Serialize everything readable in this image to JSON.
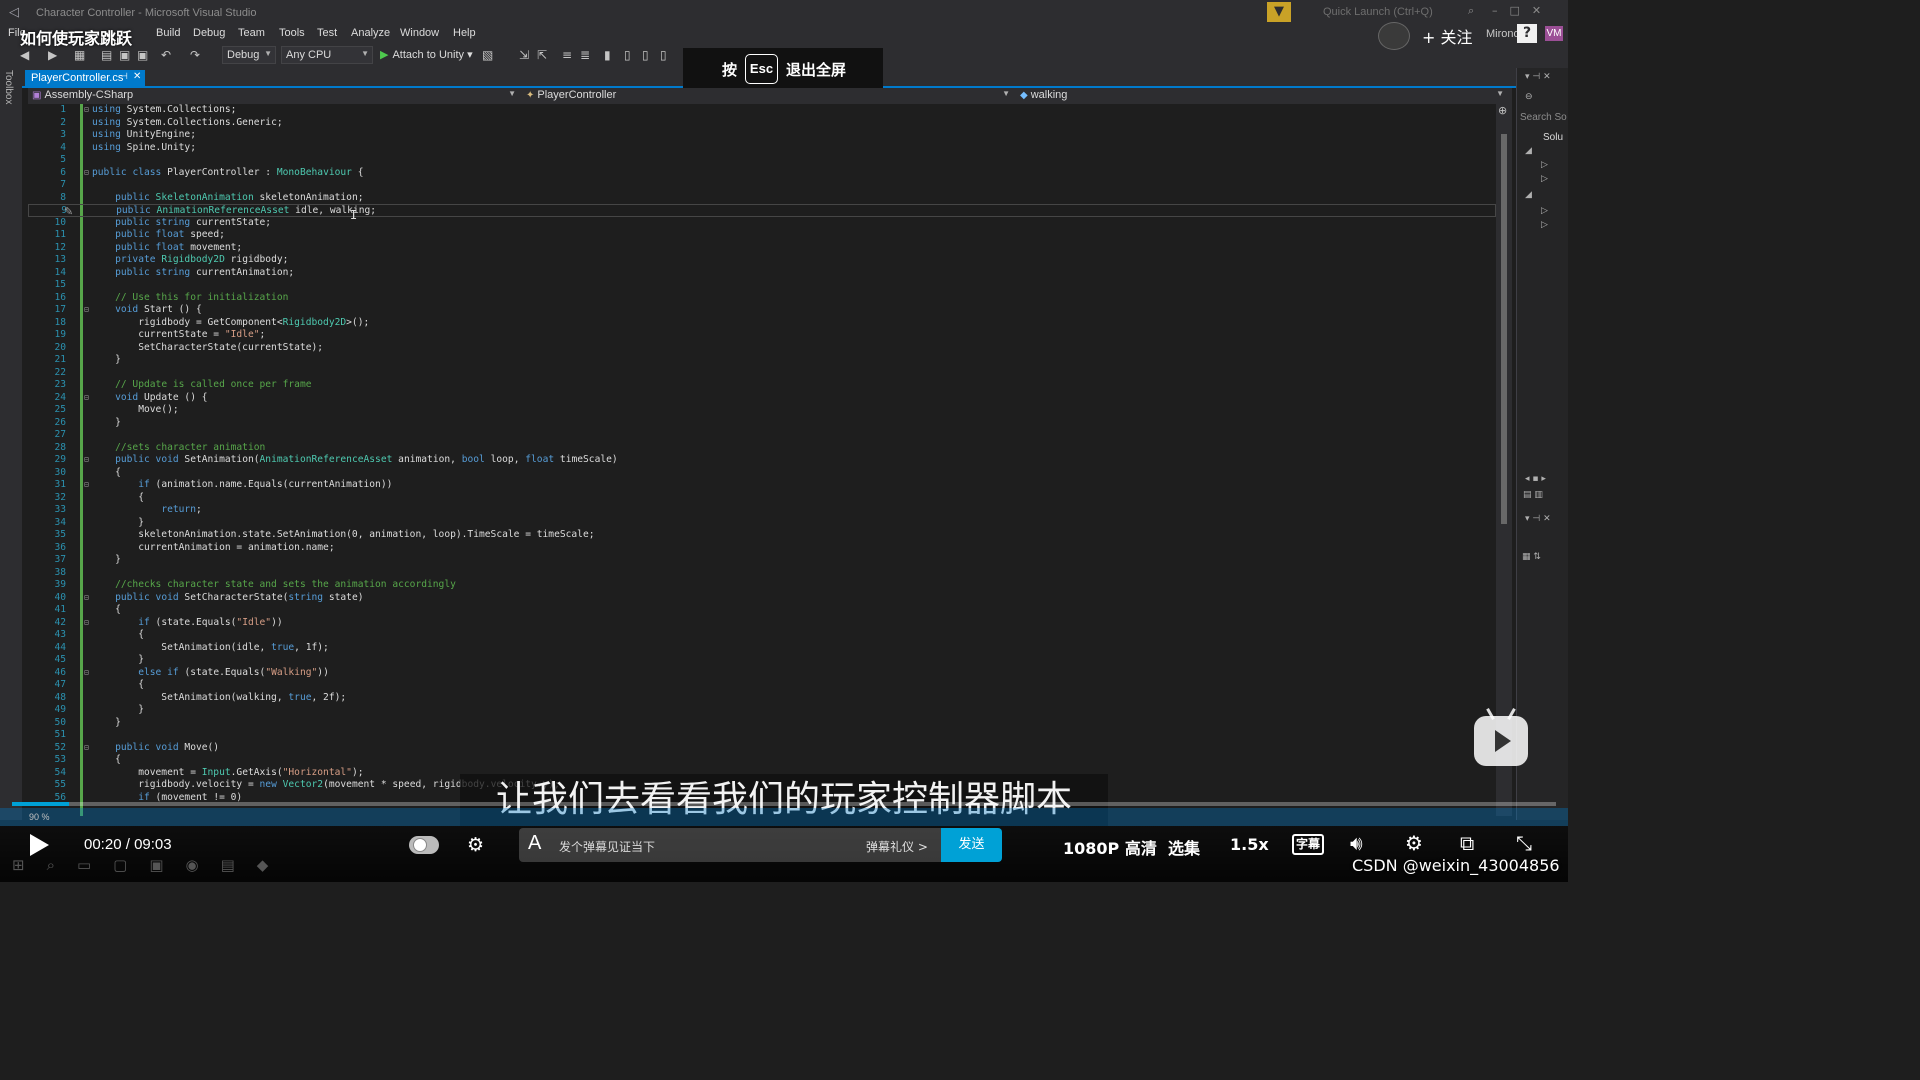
{
  "window": {
    "title": "Character Controller - Microsoft Visual Studio",
    "quick_launch_placeholder": "Quick Launch (Ctrl+Q)",
    "user_name": "Mirono",
    "user_initials": "VM",
    "help_glyph": "?"
  },
  "menu": [
    "File",
    "Build",
    "Debug",
    "Team",
    "Tools",
    "Test",
    "Analyze",
    "Window",
    "Help"
  ],
  "toolbar": {
    "config": "Debug",
    "platform": "Any CPU",
    "attach": "Attach to Unity"
  },
  "toolbox_label": "Toolbox",
  "tab": {
    "label": "PlayerController.cs"
  },
  "navbar": {
    "project": "Assembly-CSharp",
    "class": "PlayerController",
    "member": "walking"
  },
  "editor": {
    "zoom": "90 %",
    "current_line": 9,
    "lines": [
      "using System.Collections;",
      "using System.Collections.Generic;",
      "using UnityEngine;",
      "using Spine.Unity;",
      "",
      "public class PlayerController : MonoBehaviour {",
      "",
      "    public SkeletonAnimation skeletonAnimation;",
      "    public AnimationReferenceAsset idle, walking;",
      "    public string currentState;",
      "    public float speed;",
      "    public float movement;",
      "    private Rigidbody2D rigidbody;",
      "    public string currentAnimation;",
      "",
      "    // Use this for initialization",
      "    void Start () {",
      "        rigidbody = GetComponent<Rigidbody2D>();",
      "        currentState = \"Idle\";",
      "        SetCharacterState(currentState);",
      "    }",
      "",
      "    // Update is called once per frame",
      "    void Update () {",
      "        Move();",
      "    }",
      "",
      "    //sets character animation",
      "    public void SetAnimation(AnimationReferenceAsset animation, bool loop, float timeScale)",
      "    {",
      "        if (animation.name.Equals(currentAnimation))",
      "        {",
      "            return;",
      "        }",
      "        skeletonAnimation.state.SetAnimation(0, animation, loop).TimeScale = timeScale;",
      "        currentAnimation = animation.name;",
      "    }",
      "",
      "    //checks character state and sets the animation accordingly",
      "    public void SetCharacterState(string state)",
      "    {",
      "        if (state.Equals(\"Idle\"))",
      "        {",
      "            SetAnimation(idle, true, 1f);",
      "        }",
      "        else if (state.Equals(\"Walking\"))",
      "        {",
      "            SetAnimation(walking, true, 2f);",
      "        }",
      "    }",
      "",
      "    public void Move()",
      "    {",
      "        movement = Input.GetAxis(\"Horizontal\");",
      "        rigidbody.velocity = new Vector2(movement * speed, rigidbody.velocity.y);",
      "        if (movement != 0)"
    ],
    "fold_lines": [
      1,
      6,
      17,
      24,
      29,
      31,
      40,
      42,
      46,
      52
    ]
  },
  "solution_panel": {
    "search": "Search So",
    "solution": "Solu"
  },
  "overlay": {
    "video_title": "如何使玩家跳跃",
    "follow": "+ 关注",
    "esc_prefix": "按",
    "esc_key": "Esc",
    "esc_suffix": "退出全屏",
    "subtitle": "让我们去看看我们的玩家控制器脚本"
  },
  "player": {
    "current_time": "00:20",
    "separator": "/",
    "duration": "09:03",
    "progress_fraction": 0.037,
    "danmaku_placeholder": "发个弹幕见证当下",
    "danmaku_gift": "弹幕礼仪 >",
    "send": "发送",
    "quality": "1080P 高清",
    "episodes": "选集",
    "speed": "1.5x",
    "captions": "字幕",
    "watermark": "CSDN @weixin_43004856",
    "accent_color": "#00a1d6"
  }
}
